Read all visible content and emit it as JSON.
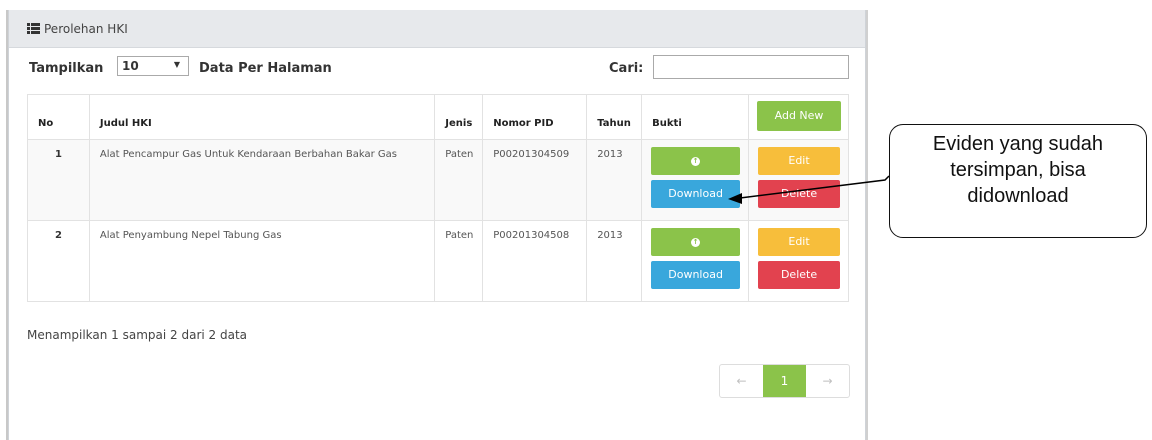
{
  "panel": {
    "title": "Perolehan HKI",
    "title_icon": "list-icon"
  },
  "controls": {
    "show_label": "Tampilkan",
    "page_size": "10",
    "per_page_label": "Data Per Halaman",
    "search_label": "Cari:",
    "search_value": ""
  },
  "table": {
    "headers": {
      "no": "No",
      "judul": "Judul HKI",
      "jenis": "Jenis",
      "nomor": "Nomor PID",
      "tahun": "Tahun",
      "bukti": "Bukti",
      "add_new": "Add New"
    },
    "rows": [
      {
        "no": "1",
        "judul": "Alat Pencampur Gas Untuk Kendaraan Berbahan Bakar Gas",
        "jenis": "Paten",
        "nomor": "P00201304509",
        "tahun": "2013",
        "upload_icon": "upload-icon",
        "download": "Download",
        "edit": "Edit",
        "delete": "Delete"
      },
      {
        "no": "2",
        "judul": "Alat Penyambung Nepel Tabung Gas",
        "jenis": "Paten",
        "nomor": "P00201304508",
        "tahun": "2013",
        "upload_icon": "upload-icon",
        "download": "Download",
        "edit": "Edit",
        "delete": "Delete"
      }
    ]
  },
  "summary": "Menampilkan 1 sampai 2 dari 2 data",
  "pagination": {
    "prev": "←",
    "current": "1",
    "next": "→"
  },
  "callout": {
    "line1": "Eviden yang sudah",
    "line2": "tersimpan, bisa",
    "line3": "didownload"
  },
  "colors": {
    "green": "#8bc34a",
    "blue": "#39a7dc",
    "yellow": "#f7be3b",
    "red": "#e2424f"
  }
}
